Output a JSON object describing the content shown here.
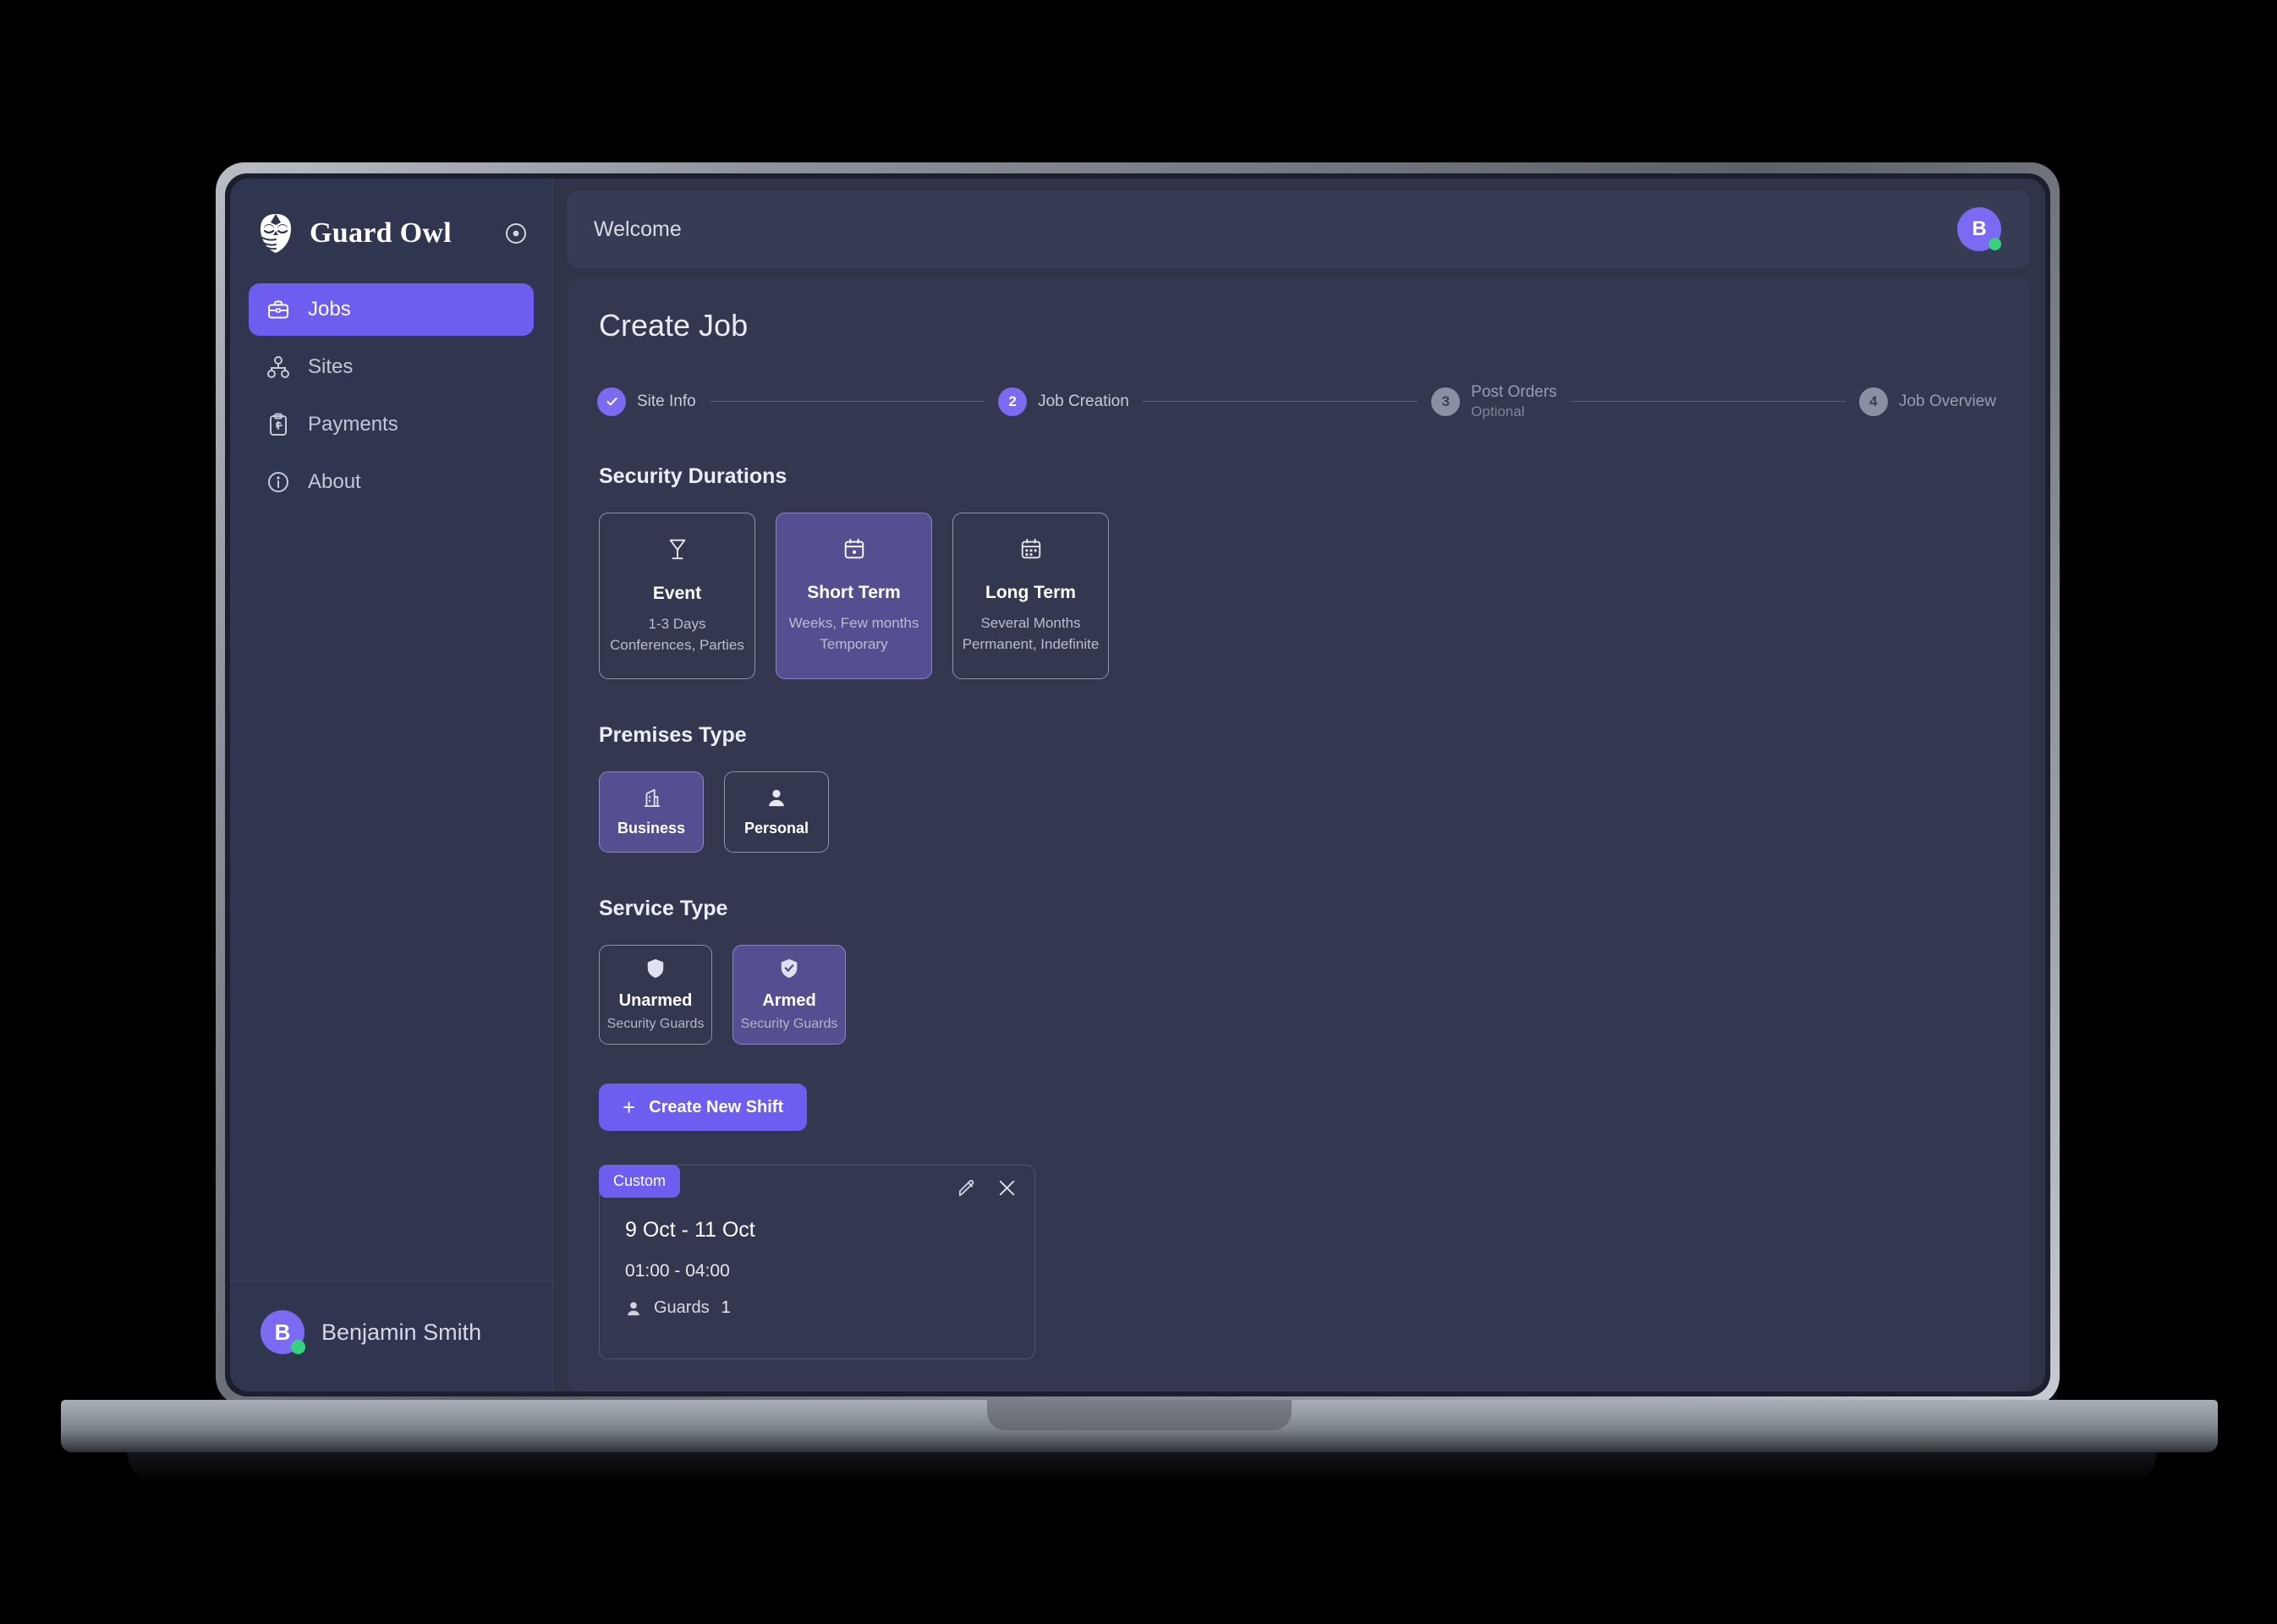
{
  "brand": {
    "name": "Guard Owl",
    "logo_icon": "owl-icon",
    "collapse_icon": "collapse-circle-icon"
  },
  "sidebar": {
    "items": [
      {
        "label": "Jobs",
        "icon": "briefcase-icon",
        "active": true
      },
      {
        "label": "Sites",
        "icon": "sitemap-icon",
        "active": false
      },
      {
        "label": "Payments",
        "icon": "clipboard-dollar-icon",
        "active": false
      },
      {
        "label": "About",
        "icon": "info-circle-icon",
        "active": false
      }
    ],
    "profile": {
      "name": "Benjamin Smith",
      "initial": "B",
      "status": "online"
    }
  },
  "topbar": {
    "welcome": "Welcome",
    "avatar_initial": "B",
    "status": "online"
  },
  "page": {
    "title": "Create Job"
  },
  "stepper": {
    "steps": [
      {
        "number": "1",
        "marker": "check",
        "label": "Site Info",
        "sub": "",
        "state": "done"
      },
      {
        "number": "2",
        "marker": "2",
        "label": "Job Creation",
        "sub": "",
        "state": "active"
      },
      {
        "number": "3",
        "marker": "3",
        "label": "Post Orders",
        "sub": "Optional",
        "state": "idle"
      },
      {
        "number": "4",
        "marker": "4",
        "label": "Job Overview",
        "sub": "",
        "state": "idle"
      }
    ]
  },
  "security_durations": {
    "title": "Security Durations",
    "options": [
      {
        "title": "Event",
        "icon": "cocktail-glass-icon",
        "line1": "1-3 Days",
        "line2": "Conferences, Parties",
        "selected": false
      },
      {
        "title": "Short Term",
        "icon": "calendar-dot-icon",
        "line1": "Weeks, Few months",
        "line2": "Temporary",
        "selected": true
      },
      {
        "title": "Long Term",
        "icon": "calendar-days-icon",
        "line1": "Several Months",
        "line2": "Permanent, Indefinite",
        "selected": false
      }
    ]
  },
  "premises_type": {
    "title": "Premises Type",
    "options": [
      {
        "title": "Business",
        "icon": "building-icon",
        "selected": true
      },
      {
        "title": "Personal",
        "icon": "person-icon",
        "selected": false
      }
    ]
  },
  "service_type": {
    "title": "Service Type",
    "options": [
      {
        "title": "Unarmed",
        "icon": "shield-icon",
        "sub": "Security Guards",
        "selected": false
      },
      {
        "title": "Armed",
        "icon": "shield-check-icon",
        "sub": "Security Guards",
        "selected": true
      }
    ]
  },
  "create_shift_button": {
    "label": "Create New Shift",
    "icon": "plus-icon"
  },
  "shift_card": {
    "chip": "Custom",
    "date_range": "9 Oct - 11 Oct",
    "time_range": "01:00 - 04:00",
    "guards_label": "Guards",
    "guards_count": "1",
    "edit_icon": "edit-pencil-icon",
    "close_icon": "close-x-icon",
    "guard_icon": "person-icon"
  },
  "colors": {
    "accent": "#6d5ef0",
    "accent_soft": "#554f91",
    "sidebar_bg": "#313650",
    "content_bg": "#333850",
    "topbar_bg": "#373c55",
    "online": "#36d07f",
    "text_primary": "#ffffff",
    "text_muted": "#b9bdcc"
  }
}
